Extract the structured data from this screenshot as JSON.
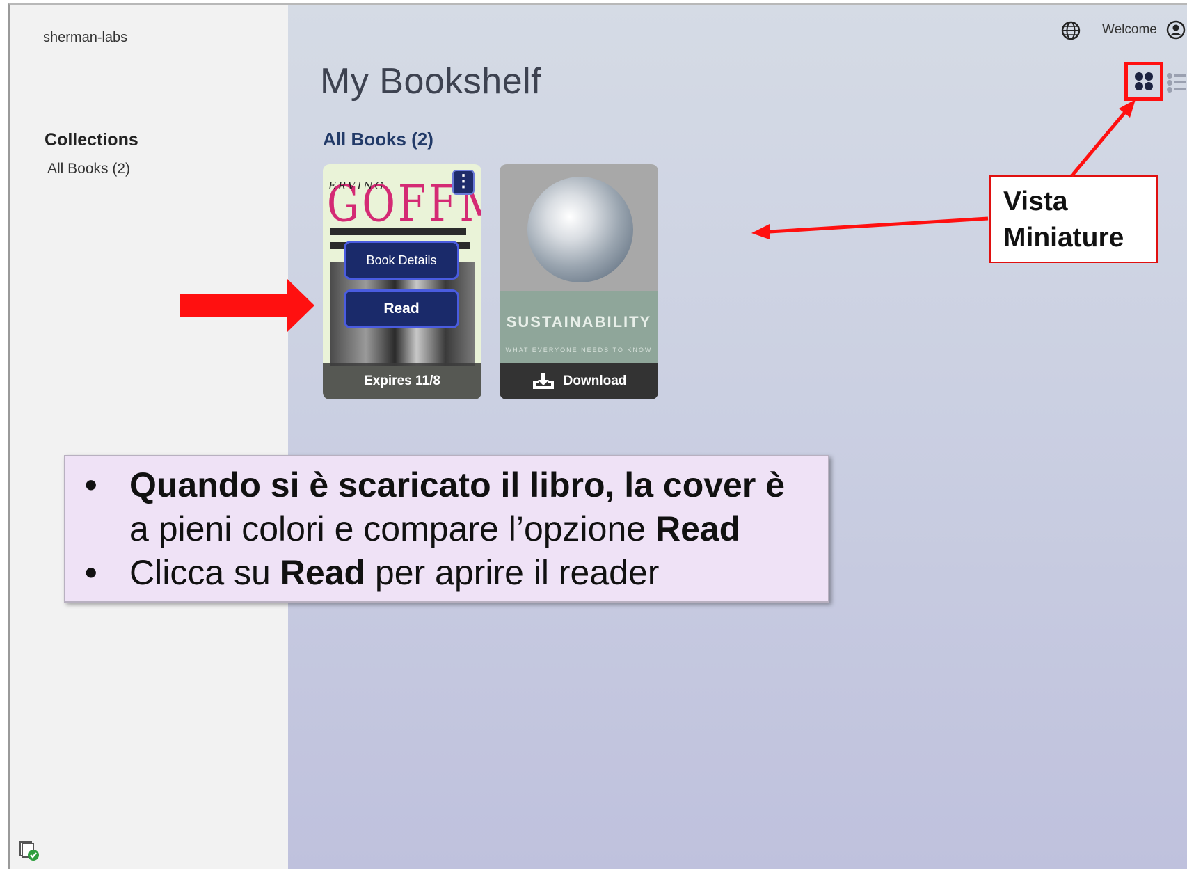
{
  "sidebar": {
    "org_name": "sherman-labs",
    "collections_title": "Collections",
    "collection_items": [
      {
        "label": "All Books (2)"
      }
    ]
  },
  "header": {
    "welcome_text": "Welcome",
    "page_title": "My Bookshelf",
    "section_title": "All Books (2)"
  },
  "books": [
    {
      "cover_author": "GOFFMAN",
      "cover_first_name": "ERVING",
      "menu_label": "⋮",
      "details_label": "Book Details",
      "read_label": "Read",
      "footer_label": "Expires 11/8"
    },
    {
      "cover_title": "SUSTAINABILITY",
      "cover_subtitle": "WHAT EVERYONE NEEDS TO KNOW",
      "footer_label": "Download"
    }
  ],
  "callout": {
    "line1": "Vista",
    "line2": "Miniature"
  },
  "note": {
    "bullet": "•",
    "line1_a": "Quando si è scaricato il libro, la cover è",
    "line2_a": "a pieni colori e compare l’opzione ",
    "line2_b": "Read",
    "line3_a": "Clicca su ",
    "line3_b": "Read",
    "line3_c": " per aprire il reader"
  },
  "colors": {
    "accent_red": "#ff1010",
    "button_navy": "#1a2a6a",
    "section_title": "#223a68"
  }
}
